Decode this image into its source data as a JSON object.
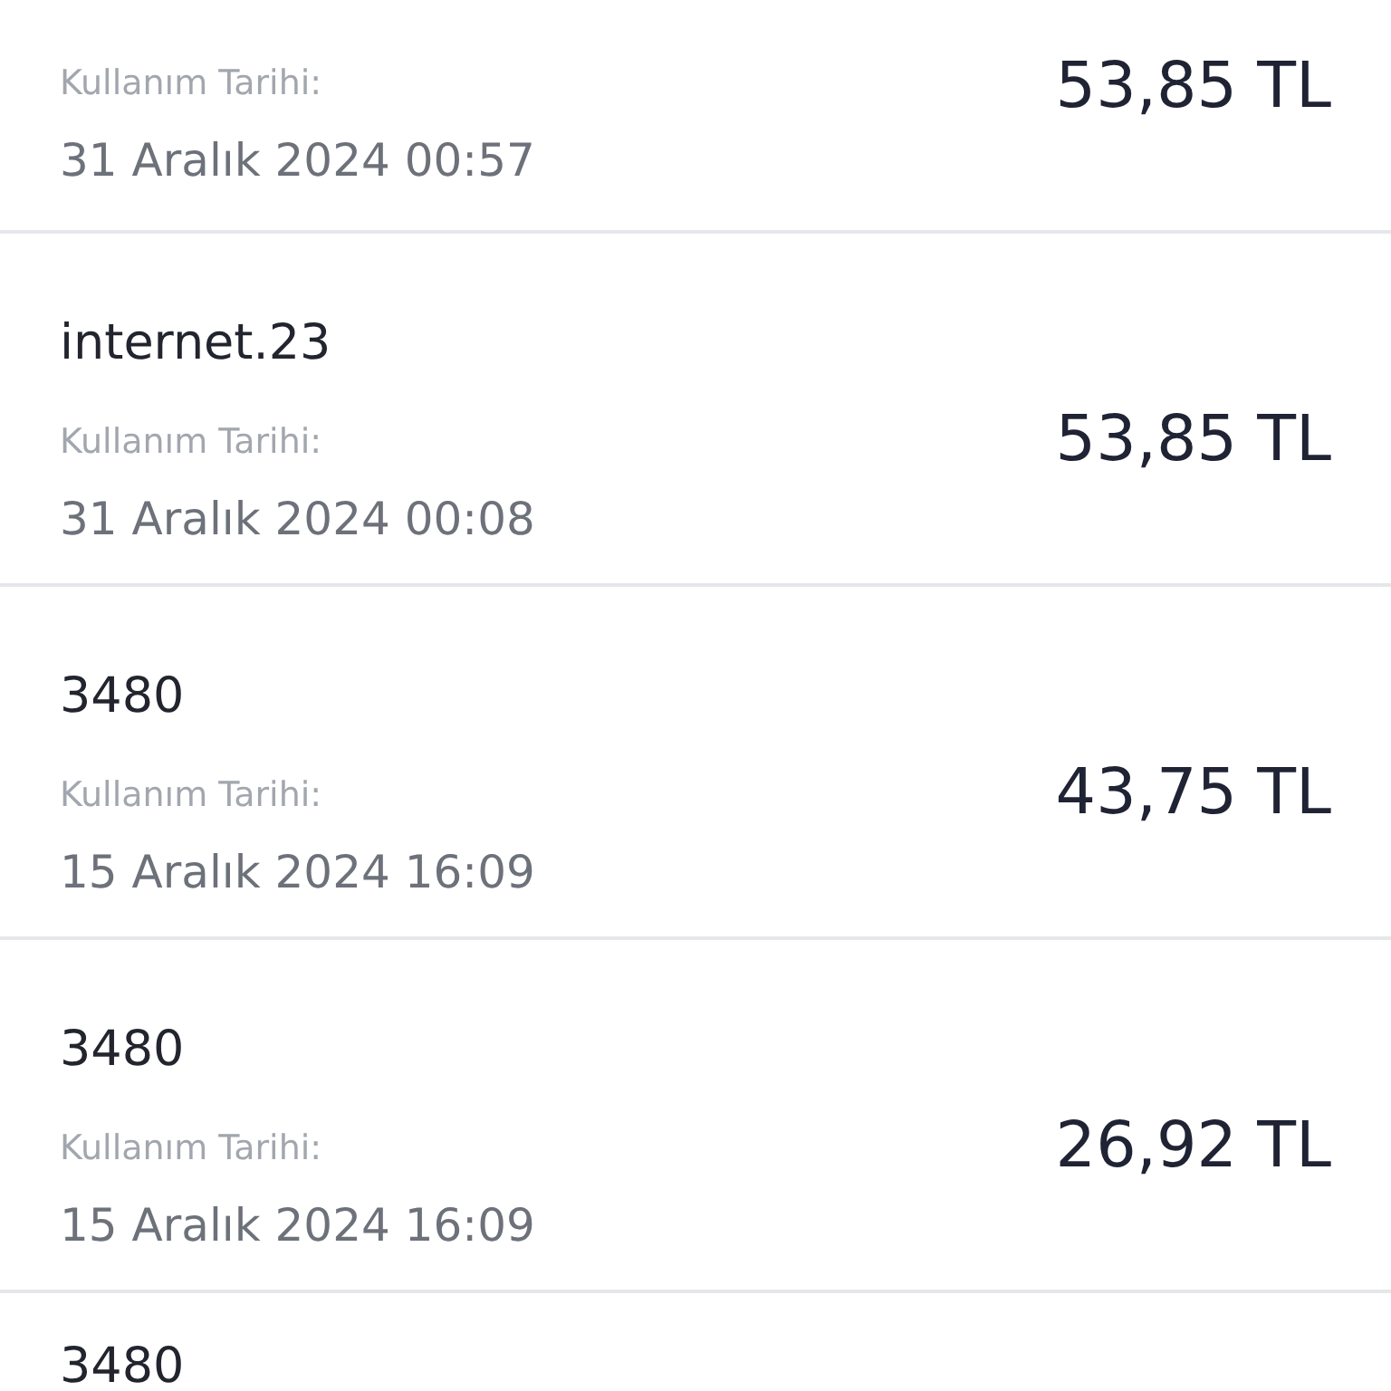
{
  "transactions": [
    {
      "label": "Kullanım Tarihi:",
      "date": "31 Aralık 2024 00:57",
      "amount": "53,85 TL"
    },
    {
      "title": "internet.23",
      "label": "Kullanım Tarihi:",
      "date": "31 Aralık 2024 00:08",
      "amount": "53,85 TL"
    },
    {
      "title": "3480",
      "label": "Kullanım Tarihi:",
      "date": "15 Aralık 2024 16:09",
      "amount": "43,75 TL"
    },
    {
      "title": "3480",
      "label": "Kullanım Tarihi:",
      "date": "15 Aralık 2024 16:09",
      "amount": "26,92 TL"
    },
    {
      "title": "3480"
    }
  ]
}
